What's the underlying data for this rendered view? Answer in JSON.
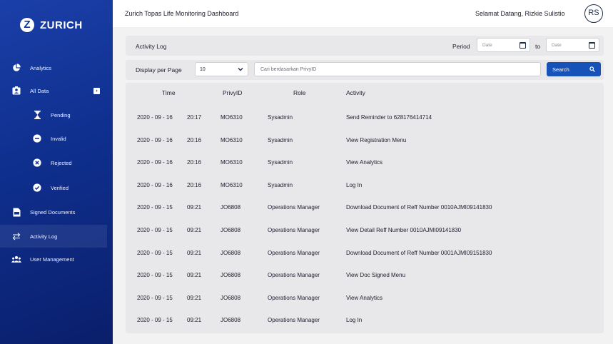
{
  "brand": {
    "name": "ZURICH",
    "mark": "Z"
  },
  "header": {
    "title": "Zurich Topas Life Monitoring Dashboard",
    "greeting": "Selamat Datang, Rizkie Sulistio",
    "avatar_initials": "RS"
  },
  "sidebar": {
    "items": [
      {
        "label": "Analytics",
        "icon": "pie-chart-icon"
      },
      {
        "label": "All Data",
        "icon": "contact-card-icon"
      },
      {
        "label": "Pending",
        "icon": "hourglass-icon"
      },
      {
        "label": "Invalid",
        "icon": "minus-circle-icon"
      },
      {
        "label": "Rejected",
        "icon": "x-circle-icon"
      },
      {
        "label": "Verified",
        "icon": "check-circle-icon"
      },
      {
        "label": "Signed Documents",
        "icon": "pdf-document-icon"
      },
      {
        "label": "Activity Log",
        "icon": "swap-arrows-icon",
        "active": true
      },
      {
        "label": "User Management",
        "icon": "users-icon"
      }
    ]
  },
  "filters": {
    "section_title": "Activity Log",
    "period_label": "Period",
    "date_from_placeholder": "Date",
    "to_label": "to",
    "date_to_placeholder": "Date",
    "display_per_page_label": "Display per Page",
    "per_page_value": "10",
    "search_placeholder": "Cari berdasarkan PrivyID",
    "search_button": "Search"
  },
  "table": {
    "headers": [
      "Time",
      "PrivyID",
      "Role",
      "Activity"
    ],
    "rows": [
      {
        "date": "2020 - 09 - 16",
        "time": "20:17",
        "privy_id": "MO6310",
        "role": "Sysadmin",
        "activity": "Send Reminder to 628176414714"
      },
      {
        "date": "2020 - 09 - 16",
        "time": "20:16",
        "privy_id": "MO6310",
        "role": "Sysadmin",
        "activity": "View Registration Menu"
      },
      {
        "date": "2020 - 09 - 16",
        "time": "20:16",
        "privy_id": "MO6310",
        "role": "Sysadmin",
        "activity": "View Analytics"
      },
      {
        "date": "2020 - 09 - 16",
        "time": "20:16",
        "privy_id": "MO6310",
        "role": "Sysadmin",
        "activity": "Log In"
      },
      {
        "date": "2020 - 09 - 15",
        "time": "09:21",
        "privy_id": "JO6808",
        "role": "Operations Manager",
        "activity": "Download Document of Reff  Number 0010AJMI09141830"
      },
      {
        "date": "2020 - 09 - 15",
        "time": "09:21",
        "privy_id": "JO6808",
        "role": "Operations Manager",
        "activity": "View Detail Reff Number 0010AJMI09141830"
      },
      {
        "date": "2020 - 09 - 15",
        "time": "09:21",
        "privy_id": "JO6808",
        "role": "Operations Manager",
        "activity": "Download Document of Reff  Number 0001AJMI09151830"
      },
      {
        "date": "2020 - 09 - 15",
        "time": "09:21",
        "privy_id": "JO6808",
        "role": "Operations Manager",
        "activity": "View Doc Signed Menu"
      },
      {
        "date": "2020 - 09 - 15",
        "time": "09:21",
        "privy_id": "JO6808",
        "role": "Operations Manager",
        "activity": "View Analytics"
      },
      {
        "date": "2020 - 09 - 15",
        "time": "09:21",
        "privy_id": "JO6808",
        "role": "Operations Manager",
        "activity": "Log In"
      }
    ]
  },
  "colors": {
    "sidebar": "#12349a",
    "primary_button": "#1652b8",
    "panel": "#e8e8ea"
  }
}
